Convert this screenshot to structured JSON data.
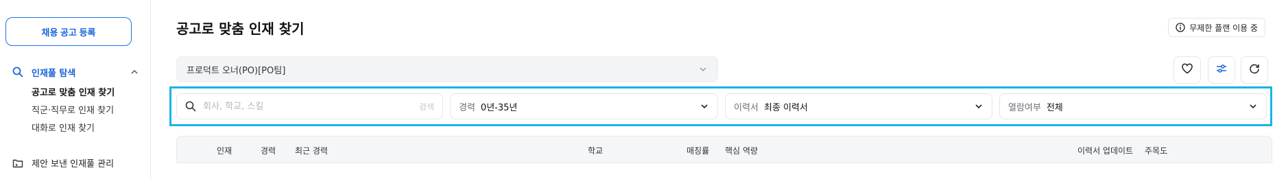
{
  "sidebar": {
    "register_button": "채용 공고 등록",
    "group": {
      "label": "인재풀 탐색",
      "icon": "search-icon",
      "items": [
        {
          "label": "공고로 맞춤 인재 찾기",
          "active": true
        },
        {
          "label": "직군·직무로 인재 찾기",
          "active": false
        },
        {
          "label": "대화로 인재 찾기",
          "active": false
        }
      ]
    },
    "sent_pool": {
      "label": "제안 보낸 인재풀 관리",
      "icon": "folder-icon"
    }
  },
  "header": {
    "title": "공고로 맞춤 인재 찾기",
    "plan_badge": "무제한 플랜 이용 중"
  },
  "position_select": {
    "value": "프로덕트 오너(PO)[PO팀]"
  },
  "actions": [
    "heart-icon",
    "filter-sliders-icon",
    "refresh-icon"
  ],
  "filters": {
    "search": {
      "placeholder": "회사, 학교, 스킬",
      "button": "검색"
    },
    "career": {
      "label": "경력",
      "value": "0년-35년"
    },
    "resume": {
      "label": "이력서",
      "value": "최종 이력서"
    },
    "viewed": {
      "label": "열람여부",
      "value": "전체"
    }
  },
  "table": {
    "columns": [
      "인재",
      "경력",
      "최근 경력",
      "학교",
      "매칭률",
      "핵심 역량",
      "이력서 업데이트",
      "주목도"
    ]
  },
  "colors": {
    "accent": "#1a63d8",
    "highlight_frame": "#19b4e6"
  }
}
